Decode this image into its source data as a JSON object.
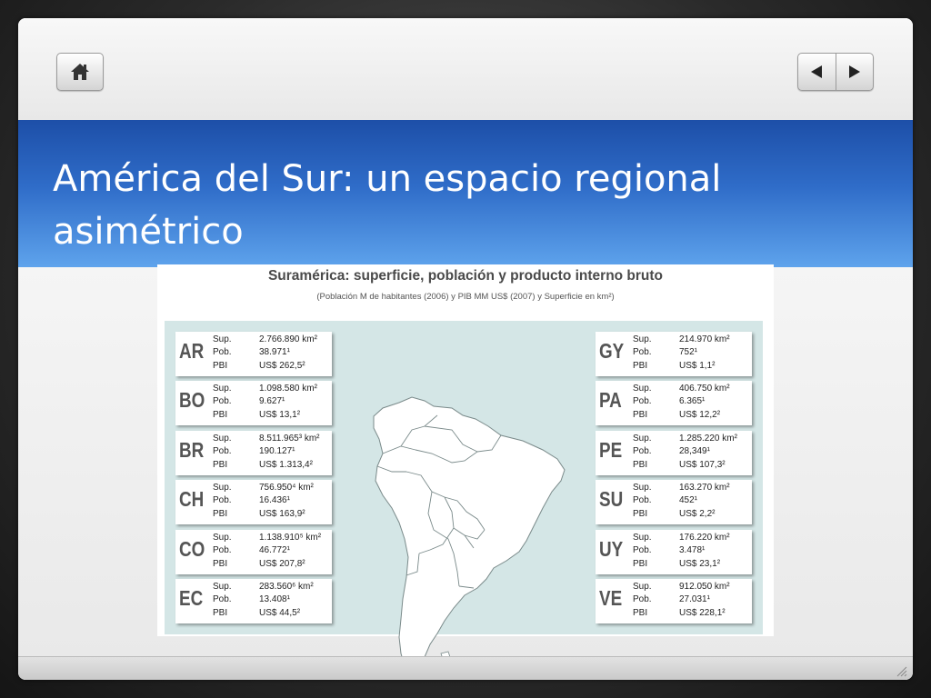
{
  "slide": {
    "title": "América del Sur: un espacio regional asimétrico",
    "nav": {
      "home": "home-icon",
      "prev": "triangle-left-icon",
      "next": "triangle-right-icon"
    }
  },
  "figure": {
    "title": "Suramérica: superficie, población y producto interno bruto",
    "subtitle": "(Población M de habitantes (2006) y PIB MM US$ (2007) y Superficie en km²)"
  },
  "labels": {
    "sup": "Sup.",
    "pob": "Pob.",
    "pbi": "PBI"
  },
  "left_cards": [
    {
      "code": "AR",
      "sup": "2.766.890 km²",
      "pob": "38.971¹",
      "pbi": "US$ 262,5²"
    },
    {
      "code": "BO",
      "sup": "1.098.580 km²",
      "pob": "9.627¹",
      "pbi": "US$ 13,1²"
    },
    {
      "code": "BR",
      "sup": "8.511.965³ km²",
      "pob": "190.127¹",
      "pbi": "US$ 1.313,4²"
    },
    {
      "code": "CH",
      "sup": "756.950⁴ km²",
      "pob": "16.436¹",
      "pbi": "US$ 163,9²"
    },
    {
      "code": "CO",
      "sup": "1.138.910⁵ km²",
      "pob": "46.772¹",
      "pbi": "US$ 207,8²"
    },
    {
      "code": "EC",
      "sup": "283.560⁶ km²",
      "pob": "13.408¹",
      "pbi": "US$ 44,5²"
    }
  ],
  "right_cards": [
    {
      "code": "GY",
      "sup": "214.970 km²",
      "pob": "752¹",
      "pbi": "US$ 1,1²"
    },
    {
      "code": "PA",
      "sup": "406.750 km²",
      "pob": "6.365¹",
      "pbi": "US$ 12,2²"
    },
    {
      "code": "PE",
      "sup": "1.285.220 km²",
      "pob": "28,349¹",
      "pbi": "US$ 107,3²"
    },
    {
      "code": "SU",
      "sup": "163.270 km²",
      "pob": "452¹",
      "pbi": "US$ 2,2²"
    },
    {
      "code": "UY",
      "sup": "176.220 km²",
      "pob": "3.478¹",
      "pbi": "US$ 23,1²"
    },
    {
      "code": "VE",
      "sup": "912.050 km²",
      "pob": "27.031¹",
      "pbi": "US$ 228,1²"
    }
  ],
  "colors": {
    "banner": "#2f6cc8",
    "map_bg": "#d4e6e6",
    "land": "#ffffff",
    "border": "#7a8a8a"
  }
}
